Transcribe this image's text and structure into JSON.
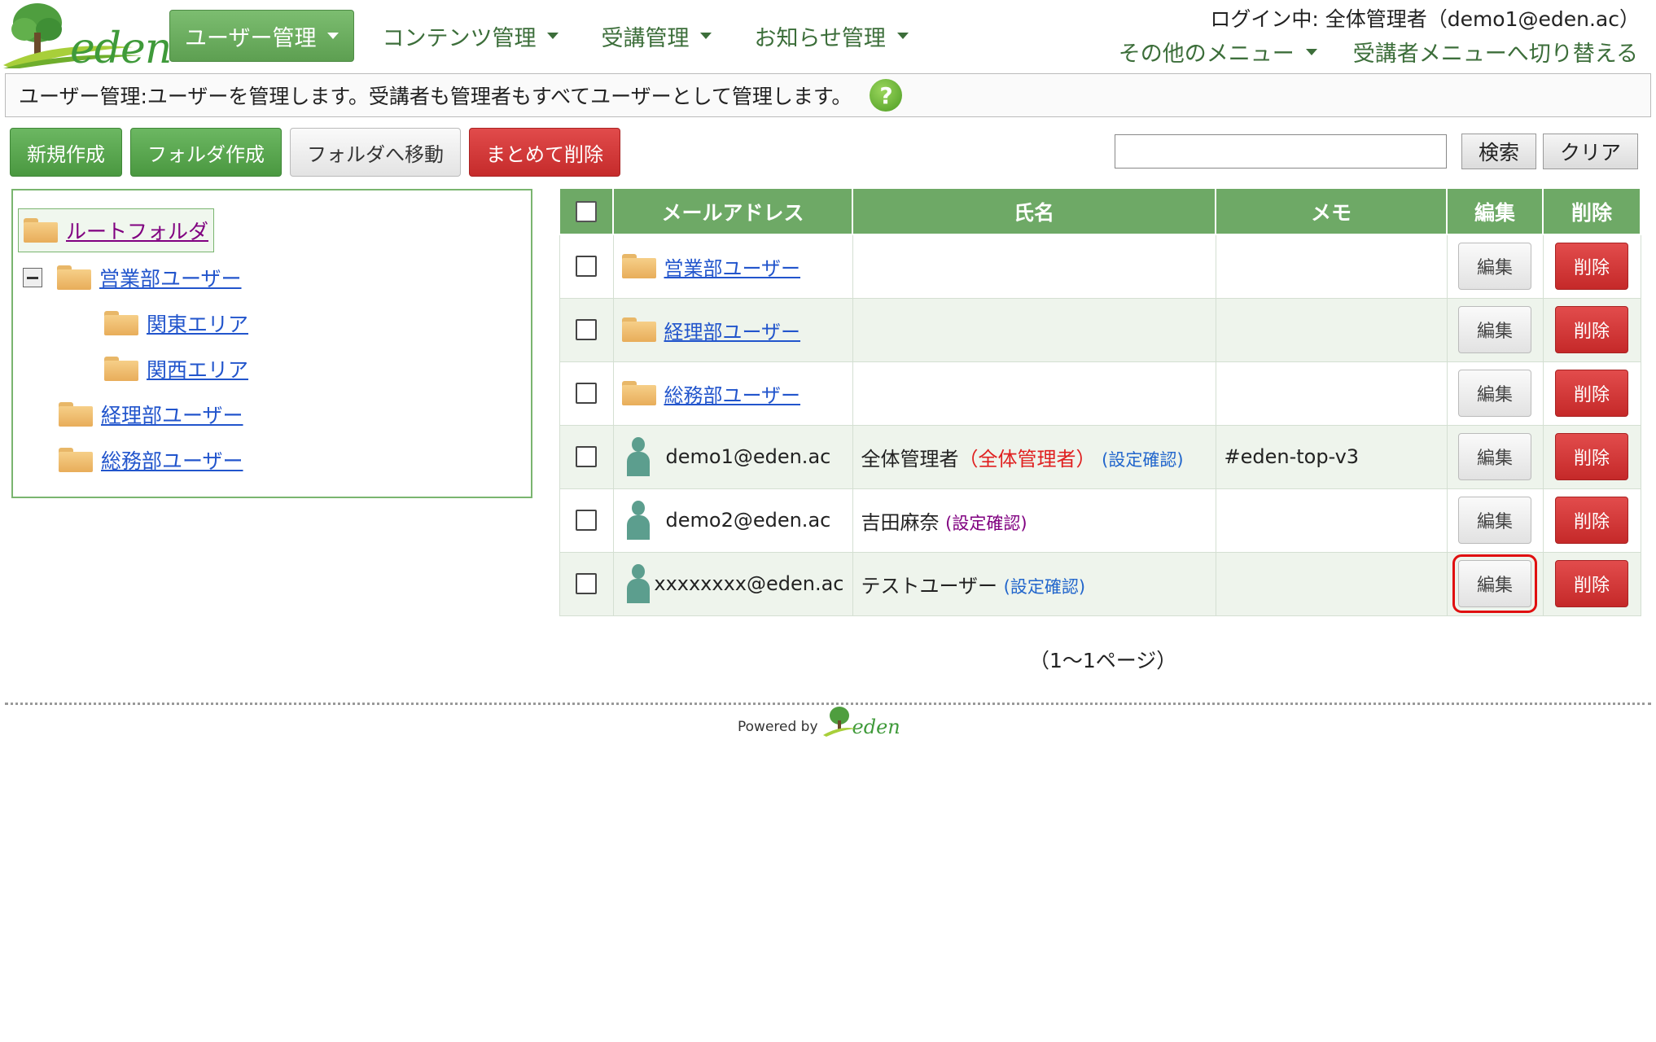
{
  "header": {
    "logo_text": "eden",
    "nav": [
      {
        "label": "ユーザー管理",
        "active": true
      },
      {
        "label": "コンテンツ管理",
        "active": false
      },
      {
        "label": "受講管理",
        "active": false
      },
      {
        "label": "お知らせ管理",
        "active": false
      }
    ],
    "login_info": "ログイン中: 全体管理者（demo1@eden.ac）",
    "other_menu": "その他のメニュー",
    "switch_menu": "受講者メニューへ切り替える"
  },
  "description": "ユーザー管理:ユーザーを管理します。受講者も管理者もすべてユーザーとして管理します。",
  "toolbar": {
    "new": "新規作成",
    "new_folder": "フォルダ作成",
    "move_folder": "フォルダへ移動",
    "bulk_delete": "まとめて削除",
    "search_value": "",
    "search": "検索",
    "clear": "クリア"
  },
  "tree": {
    "root": "ルートフォルダ",
    "sales": "営業部ユーザー",
    "kanto": "関東エリア",
    "kansai": "関西エリア",
    "accounting": "経理部ユーザー",
    "general": "総務部ユーザー"
  },
  "table": {
    "headers": {
      "email": "メールアドレス",
      "name": "氏名",
      "memo": "メモ",
      "edit": "編集",
      "delete": "削除"
    },
    "rows": [
      {
        "email": "営業部ユーザー",
        "name": "",
        "name_extra": "",
        "confirm": "",
        "memo": "",
        "edit": "編集",
        "delete": "削除"
      },
      {
        "email": "経理部ユーザー",
        "name": "",
        "name_extra": "",
        "confirm": "",
        "memo": "",
        "edit": "編集",
        "delete": "削除"
      },
      {
        "email": "総務部ユーザー",
        "name": "",
        "name_extra": "",
        "confirm": "",
        "memo": "",
        "edit": "編集",
        "delete": "削除"
      },
      {
        "email": "demo1@eden.ac",
        "name": "全体管理者",
        "name_extra": "（全体管理者）",
        "confirm": "(設定確認)",
        "memo": "#eden-top-v3",
        "edit": "編集",
        "delete": "削除"
      },
      {
        "email": "demo2@eden.ac",
        "name": "吉田麻奈",
        "name_extra": "",
        "confirm": "(設定確認)",
        "memo": "",
        "edit": "編集",
        "delete": "削除"
      },
      {
        "email": "xxxxxxxx@eden.ac",
        "name": "テストユーザー",
        "name_extra": "",
        "confirm": "(設定確認)",
        "memo": "",
        "edit": "編集",
        "delete": "削除"
      }
    ]
  },
  "pager": "（1〜1ページ）",
  "footer": {
    "powered_by": "Powered by",
    "logo": "eden"
  },
  "colors": {
    "accent_green": "#6ea966",
    "danger_red": "#c52b2b",
    "highlight": "#e01010"
  }
}
